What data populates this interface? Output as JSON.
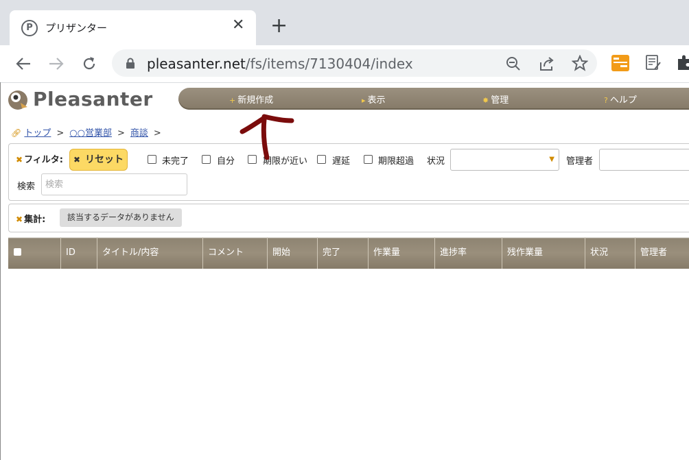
{
  "browser": {
    "tab_title": "プリザンター",
    "tab_favicon_letter": "P",
    "url_host": "pleasanter.net",
    "url_path": "/fs/items/7130404/index"
  },
  "app": {
    "logo_text": "Pleasanter",
    "menu": [
      {
        "label": "新規作成",
        "mark": "+"
      },
      {
        "label": "表示",
        "mark": "▸"
      },
      {
        "label": "管理",
        "mark": "✸"
      },
      {
        "label": "ヘルプ",
        "mark": "?"
      }
    ]
  },
  "breadcrumb": {
    "items": [
      "トップ",
      "○○営業部",
      "商談"
    ],
    "separator": ">"
  },
  "filter": {
    "label": "フィルタ:",
    "reset_label": "リセット",
    "checkboxes": [
      "未完了",
      "自分",
      "期限が近い",
      "遅延",
      "期限超過"
    ],
    "status_label": "状況",
    "manager_label": "管理者",
    "search_label": "検索",
    "search_placeholder": "検索"
  },
  "aggregation": {
    "label": "集計:",
    "empty_message": "該当するデータがありません"
  },
  "grid": {
    "columns": [
      "ID",
      "タイトル/内容",
      "コメント",
      "開始",
      "完了",
      "作業量",
      "進捗率",
      "残作業量",
      "状況",
      "管理者"
    ]
  },
  "colors": {
    "menubar": "#8e8472",
    "reset_button": "#fcd964",
    "annotation_arrow": "#7b0c0c",
    "link": "#3355aa"
  }
}
